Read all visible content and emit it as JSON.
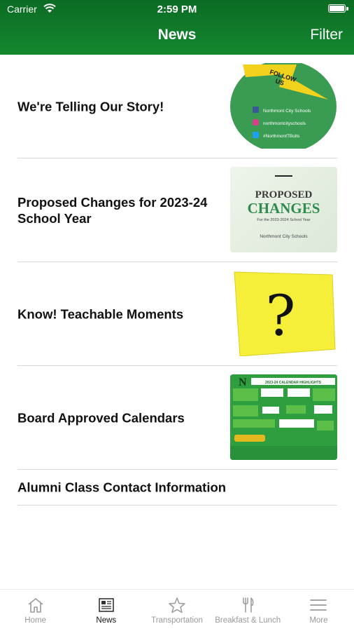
{
  "status_bar": {
    "carrier": "Carrier",
    "time": "2:59 PM"
  },
  "header": {
    "title": "News",
    "filter_label": "Filter"
  },
  "news": [
    {
      "title": "We're Telling Our Story!",
      "thumb": {
        "banner_line1": "FOLLOW",
        "banner_line2": "US",
        "socials": [
          "Northmont City Schools",
          "northmontcityschools",
          "#NorthmontTBolts"
        ]
      }
    },
    {
      "title": "Proposed Changes for 2023-24 School Year",
      "thumb": {
        "line1": "PROPOSED",
        "line2": "CHANGES",
        "line3": "For the 2023-2024 School Year",
        "line4": "Northmont City Schools"
      }
    },
    {
      "title": "Know! Teachable Moments",
      "thumb": {
        "symbol": "?"
      }
    },
    {
      "title": "Board Approved Calendars",
      "thumb": {
        "letter": "N",
        "heading": "2023-24 CALENDAR HIGHLIGHTS"
      }
    },
    {
      "title": "Alumni Class Contact Information"
    }
  ],
  "tabs": [
    {
      "label": "Home",
      "icon": "home-icon"
    },
    {
      "label": "News",
      "icon": "newspaper-icon"
    },
    {
      "label": "Transportation",
      "icon": "star-icon"
    },
    {
      "label": "Breakfast & Lunch",
      "icon": "utensils-icon"
    },
    {
      "label": "More",
      "icon": "hamburger-menu-icon"
    }
  ],
  "colors": {
    "header_green": "#14882f",
    "thumb_green": "#3a9b52",
    "sticky_yellow": "#f5ef3a"
  }
}
